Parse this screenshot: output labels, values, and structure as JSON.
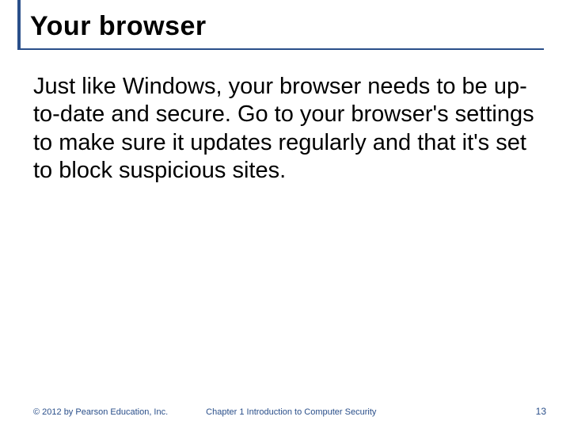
{
  "title": "Your browser",
  "body": "Just like Windows, your browser needs to be up-to-date and secure. Go to your browser's settings to make sure it updates regularly and that it's set to block suspicious sites.",
  "footer": {
    "copyright": "© 2012 by Pearson Education, Inc.",
    "chapter": "Chapter 1  Introduction to Computer Security",
    "page": "13"
  }
}
